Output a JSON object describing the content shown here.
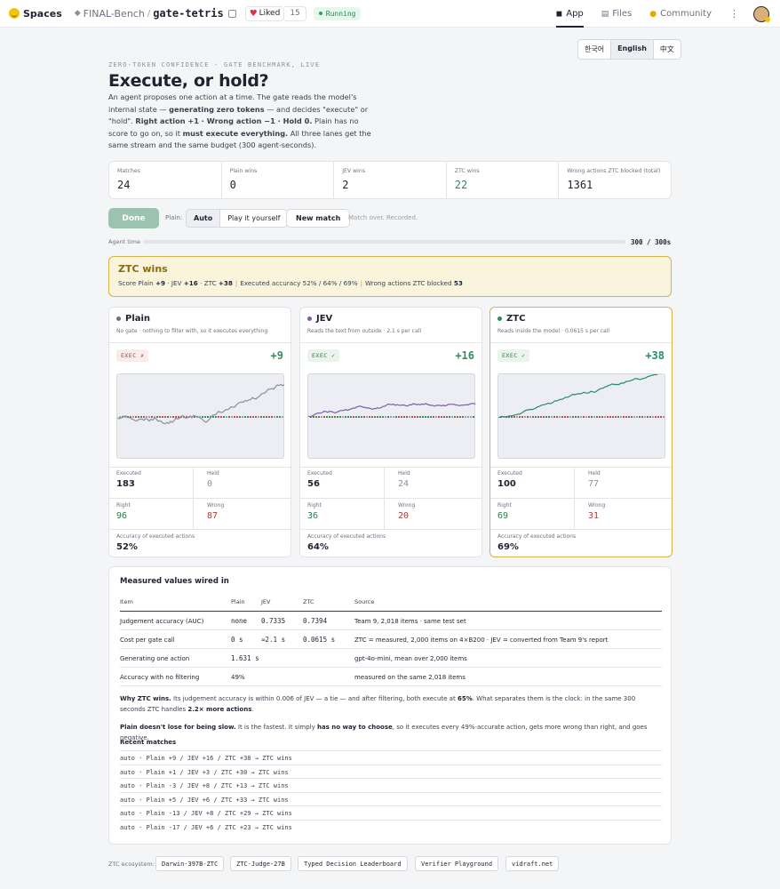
{
  "topbar": {
    "spaces": "Spaces",
    "org": "FINAL-Bench",
    "slash": "/",
    "repo": "gate-tetris",
    "liked": "Liked",
    "like_count": "15",
    "status": "Running",
    "nav": [
      {
        "label": "App",
        "icon": "app-icon"
      },
      {
        "label": "Files",
        "icon": "files-icon"
      },
      {
        "label": "Community",
        "icon": "community-icon"
      }
    ]
  },
  "languages": [
    "한국어",
    "English",
    "中文"
  ],
  "hero": {
    "eyebrow": "ZERO-TOKEN CONFIDENCE · GATE BENCHMARK, LIVE",
    "title": "Execute, or hold?",
    "intro_a": "An agent proposes one action at a time. The gate reads the model's internal state — ",
    "intro_b": "generating zero tokens",
    "intro_c": " — and decides \"execute\" or \"hold\". ",
    "intro_d": "Right action +1 · Wrong action −1 · Hold 0.",
    "intro_e": " Plain has no score to go on, so it ",
    "intro_f": "must execute everything.",
    "intro_g": " All three lanes get the same stream and the same budget (300 agent-seconds)."
  },
  "stats": [
    {
      "label": "Matches",
      "value": "24"
    },
    {
      "label": "Plain wins",
      "value": "0"
    },
    {
      "label": "JEV wins",
      "value": "2"
    },
    {
      "label": "ZTC wins",
      "value": "22"
    },
    {
      "label": "Wrong actions ZTC blocked (total)",
      "value": "1361"
    }
  ],
  "controls": {
    "done": "Done",
    "plain_label": "Plain:",
    "auto": "Auto",
    "play": "Play it yourself",
    "new_match": "New match",
    "status": "Match over. Recorded."
  },
  "agent_time": {
    "label": "Agent time",
    "value": "300 / 300s",
    "progress": 1.0
  },
  "winner": {
    "title": "ZTC wins",
    "score_label": "Score Plain",
    "plain": "+9",
    "jev_label": "· JEV",
    "jev": "+16",
    "ztc_label": "· ZTC",
    "ztc": "+38",
    "acc": "Executed accuracy 52% / 64% / 69%",
    "blocked_label": "Wrong actions ZTC blocked",
    "blocked": "53"
  },
  "lanes": [
    {
      "name": "Plain",
      "dot": "#6b7280",
      "desc": "No gate · nothing to filter with, so it executes everything",
      "badge": "EXEC ✗",
      "score": "+9",
      "score_color": "#3d8a5e",
      "line_color": "#8a8f99",
      "executed_label": "Executed",
      "executed": "183",
      "held_label": "Held",
      "held": "0",
      "right_label": "Right",
      "right": "96",
      "wrong_label": "Wrong",
      "wrong": "87",
      "acc_label": "Accuracy of executed actions",
      "acc": "52%"
    },
    {
      "name": "JEV",
      "dot": "#7b5ea8",
      "desc": "Reads the text from outside · 2.1 s per call",
      "badge": "EXEC ✓",
      "score": "+16",
      "score_color": "#3d8a5e",
      "line_color": "#7b5ea8",
      "executed_label": "Executed",
      "executed": "56",
      "held_label": "Held",
      "held": "24",
      "right_label": "Right",
      "right": "36",
      "wrong_label": "Wrong",
      "wrong": "20",
      "acc_label": "Accuracy of executed actions",
      "acc": "64%"
    },
    {
      "name": "ZTC",
      "dot": "#2a8a6a",
      "desc": "Reads inside the model · 0.0615 s per call",
      "badge": "EXEC ✓",
      "score": "+38",
      "score_color": "#2a8a6a",
      "line_color": "#2a8a6a",
      "executed_label": "Executed",
      "executed": "100",
      "held_label": "Held",
      "held": "77",
      "right_label": "Right",
      "right": "69",
      "wrong_label": "Wrong",
      "wrong": "31",
      "acc_label": "Accuracy of executed actions",
      "acc": "69%"
    }
  ],
  "wired": {
    "title": "Measured values wired in",
    "headers": [
      "Item",
      "Plain",
      "JEV",
      "ZTC",
      "Source"
    ],
    "rows": [
      [
        "Judgement accuracy (AUC)",
        "none",
        "0.7335",
        "0.7394",
        "Team 9, 2,018 items · same test set"
      ],
      [
        "Cost per gate call",
        "0 s",
        "≈2.1 s",
        "0.0615 s",
        "ZTC = measured, 2,000 items on 4×B200 · JEV = converted from Team 9's report"
      ],
      [
        "Generating one action",
        "1.631 s",
        "",
        "",
        "gpt-4o-mini, mean over 2,000 items"
      ],
      [
        "Accuracy with no filtering",
        "49%",
        "",
        "",
        "measured on the same 2,018 items"
      ]
    ],
    "why_a": "Why ZTC wins.",
    "why_b": " Its judgement accuracy is within 0.006 of JEV — a tie — and after filtering, both execute at ",
    "why_c": "65%",
    "why_d": ". What separates them is the clock: in the same 300 seconds ZTC handles ",
    "why_e": "2.2× more actions",
    "why_f": ".",
    "plain_a": "Plain doesn't lose for being slow.",
    "plain_b": " It is the fastest. It simply ",
    "plain_c": "has no way to choose",
    "plain_d": ", so it executes every 49%-accurate action, gets more wrong than right, and goes negative.",
    "recent_title": "Recent matches",
    "recent": [
      "auto · Plain +9 / JEV +16 / ZTC +38 → ZTC wins",
      "auto · Plain +1 / JEV +3 / ZTC +30 → ZTC wins",
      "auto · Plain -3 / JEV +8 / ZTC +13 → ZTC wins",
      "auto · Plain +5 / JEV +6 / ZTC +33 → ZTC wins",
      "auto · Plain -13 / JEV +8 / ZTC +29 → ZTC wins",
      "auto · Plain -17 / JEV +6 / ZTC +23 → ZTC wins"
    ]
  },
  "footer": {
    "label": "ZTC ecosystem:",
    "links": [
      "Darwin-397B-ZTC",
      "ZTC-Judge-27B",
      "Typed Decision Leaderboard",
      "Verifier Playground",
      "vidraft.net"
    ]
  }
}
